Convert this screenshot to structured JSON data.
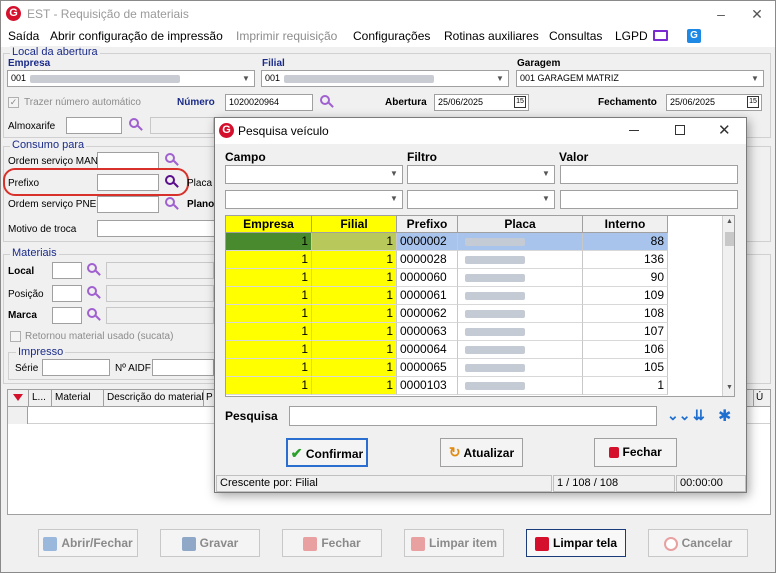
{
  "window": {
    "title": "EST - Requisição de materiais",
    "minimize": "–",
    "close": "✕"
  },
  "menu": {
    "items": [
      "Saída",
      "Abrir configuração de impressão",
      "Imprimir requisição",
      "Configurações",
      "Rotinas auxiliares",
      "Consultas",
      "LGPD"
    ]
  },
  "local_abertura": {
    "group": "Local da abertura",
    "empresa_label": "Empresa",
    "empresa_value": "001",
    "filial_label": "Filial",
    "filial_value": "001",
    "garagem_label": "Garagem",
    "garagem_value": "001 GARAGEM MATRIZ",
    "trazer_label": "Trazer número automático",
    "numero_label": "Número",
    "numero_value": "1020020964",
    "abertura_label": "Abertura",
    "abertura_value": "25/06/2025",
    "fechamento_label": "Fechamento",
    "fechamento_value": "25/06/2025",
    "almoxarife_label": "Almoxarife"
  },
  "consumo": {
    "group": "Consumo para",
    "os_man_label": "Ordem serviço MAN",
    "prefixo_label": "Prefixo",
    "placa_label": "Placa",
    "os_pne_label": "Ordem serviço PNE",
    "plano_label": "Plano",
    "motivo_label": "Motivo de troca"
  },
  "materiais": {
    "group": "Materiais",
    "local_label": "Local",
    "posicao_label": "Posição",
    "marca_label": "Marca",
    "retornou_label": "Retornou material usado (sucata)",
    "impresso_group": "Impresso",
    "serie_label": "Série",
    "aidf_label": "Nº AIDF",
    "columns": [
      "L...",
      "Material",
      "Descrição do material",
      "P",
      "Ú"
    ]
  },
  "bottom_buttons": {
    "abrir": "Abrir/Fechar",
    "gravar": "Gravar",
    "fechar": "Fechar",
    "limpar_item": "Limpar item",
    "limpar_tela": "Limpar tela",
    "cancelar": "Cancelar"
  },
  "dialog": {
    "title": "Pesquisa veículo",
    "campo_label": "Campo",
    "filtro_label": "Filtro",
    "valor_label": "Valor",
    "columns": [
      "Empresa",
      "Filial",
      "Prefixo",
      "Placa",
      "Interno"
    ],
    "rows": [
      {
        "empresa": "1",
        "filial": "1",
        "prefixo": "0000002",
        "interno": "88"
      },
      {
        "empresa": "1",
        "filial": "1",
        "prefixo": "0000028",
        "interno": "136"
      },
      {
        "empresa": "1",
        "filial": "1",
        "prefixo": "0000060",
        "interno": "90"
      },
      {
        "empresa": "1",
        "filial": "1",
        "prefixo": "0000061",
        "interno": "109"
      },
      {
        "empresa": "1",
        "filial": "1",
        "prefixo": "0000062",
        "interno": "108"
      },
      {
        "empresa": "1",
        "filial": "1",
        "prefixo": "0000063",
        "interno": "107"
      },
      {
        "empresa": "1",
        "filial": "1",
        "prefixo": "0000064",
        "interno": "106"
      },
      {
        "empresa": "1",
        "filial": "1",
        "prefixo": "0000065",
        "interno": "105"
      },
      {
        "empresa": "1",
        "filial": "1",
        "prefixo": "0000103",
        "interno": "1"
      }
    ],
    "pesquisa_label": "Pesquisa",
    "confirmar": "Confirmar",
    "atualizar": "Atualizar",
    "fechar": "Fechar",
    "status_order": "Crescente por: Filial",
    "status_count": "1 / 108 / 108",
    "status_time": "00:00:00"
  },
  "colors": {
    "yellow": "#ffff00",
    "selected": "#a9c4ec",
    "accent": "#d4102c"
  }
}
